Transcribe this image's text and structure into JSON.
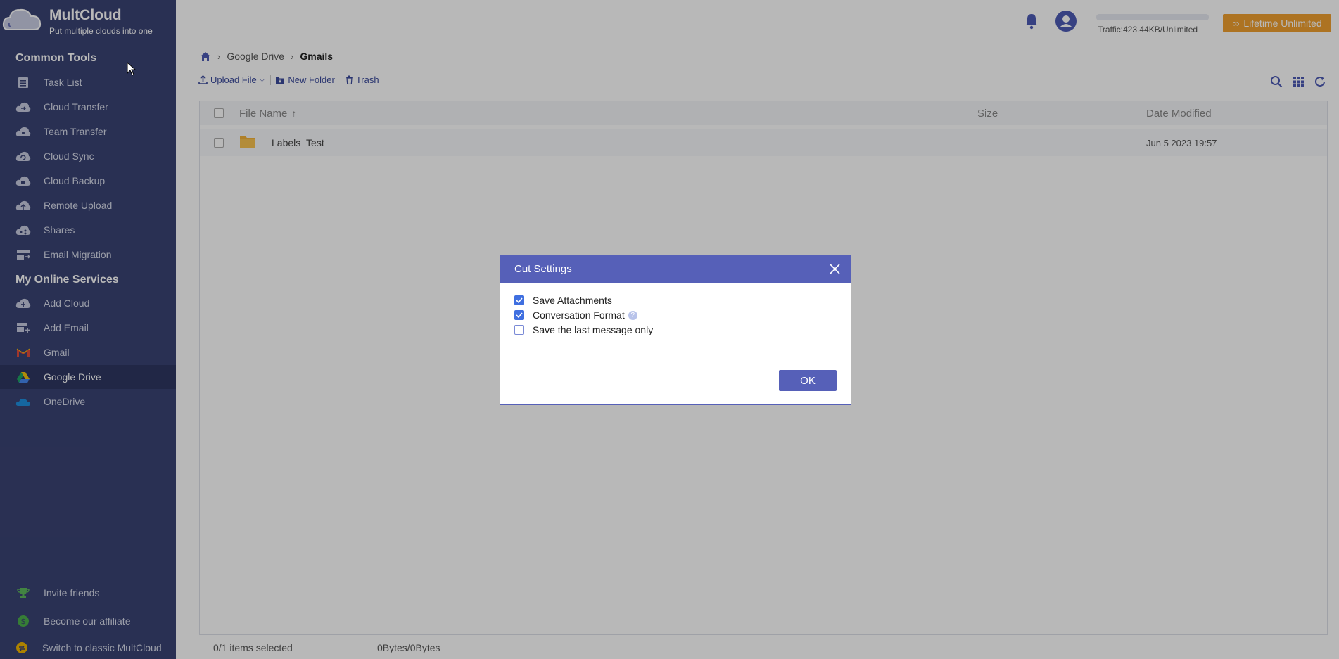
{
  "brand": {
    "name": "MultCloud",
    "tagline": "Put multiple clouds into one"
  },
  "sidebar": {
    "common_tools_title": "Common Tools",
    "common_tools": [
      {
        "label": "Task List",
        "icon": "clipboard-icon"
      },
      {
        "label": "Cloud Transfer",
        "icon": "cloud-transfer-icon"
      },
      {
        "label": "Team Transfer",
        "icon": "team-transfer-icon"
      },
      {
        "label": "Cloud Sync",
        "icon": "cloud-sync-icon"
      },
      {
        "label": "Cloud Backup",
        "icon": "cloud-backup-icon"
      },
      {
        "label": "Remote Upload",
        "icon": "cloud-upload-icon"
      },
      {
        "label": "Shares",
        "icon": "share-icon"
      },
      {
        "label": "Email Migration",
        "icon": "email-migration-icon"
      }
    ],
    "services_title": "My Online Services",
    "services": [
      {
        "label": "Add Cloud",
        "icon": "add-cloud-icon"
      },
      {
        "label": "Add Email",
        "icon": "add-email-icon"
      },
      {
        "label": "Gmail",
        "icon": "gmail-icon"
      },
      {
        "label": "Google Drive",
        "icon": "google-drive-icon",
        "active": true
      },
      {
        "label": "OneDrive",
        "icon": "onedrive-icon"
      }
    ],
    "footer": [
      {
        "label": "Invite friends",
        "icon": "trophy-icon"
      },
      {
        "label": "Become our affiliate",
        "icon": "dollar-icon"
      },
      {
        "label": "Switch to classic MultCloud",
        "icon": "switch-icon"
      }
    ]
  },
  "topbar": {
    "traffic": "Traffic:423.44KB/Unlimited",
    "lifetime_label": "Lifetime Unlimited"
  },
  "breadcrumb": {
    "items": [
      "Google Drive",
      "Gmails"
    ]
  },
  "toolbar": {
    "upload": "Upload File",
    "new_folder": "New Folder",
    "trash": "Trash"
  },
  "table": {
    "headers": {
      "name": "File Name",
      "size": "Size",
      "date": "Date Modified"
    },
    "rows": [
      {
        "name": "Labels_Test",
        "size": "",
        "date": "Jun 5 2023 19:57"
      }
    ]
  },
  "status": {
    "selected": "0/1 items selected",
    "bytes": "0Bytes/0Bytes"
  },
  "dialog": {
    "title": "Cut Settings",
    "options": [
      {
        "label": "Save Attachments",
        "checked": true
      },
      {
        "label": "Conversation Format",
        "checked": true,
        "help": "?"
      },
      {
        "label": "Save the last message only",
        "checked": false
      }
    ],
    "ok": "OK"
  },
  "colors": {
    "sidebar": "#3a4373",
    "accent": "#5660b8",
    "lifetime": "#f0a030"
  }
}
